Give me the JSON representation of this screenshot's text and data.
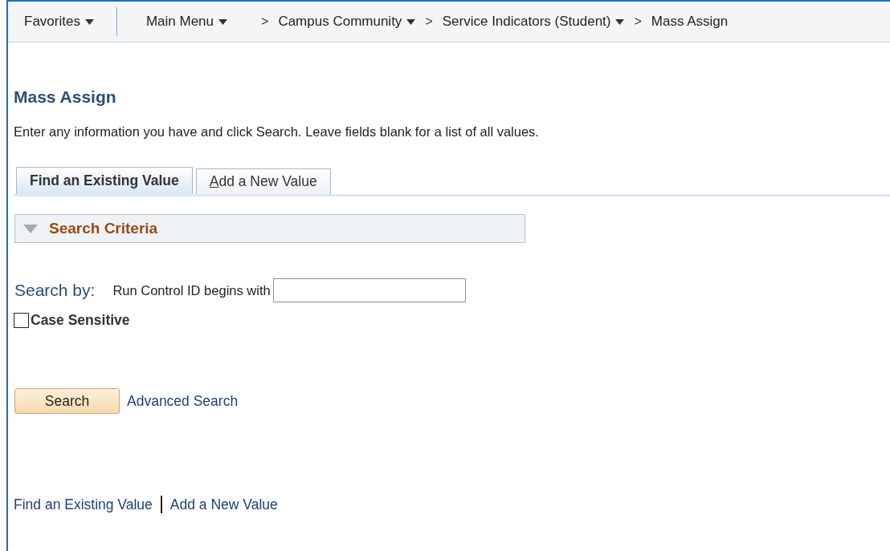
{
  "breadcrumb": {
    "favorites": {
      "label": "Favorites",
      "dropdown": true
    },
    "items": [
      {
        "label": "Main Menu",
        "dropdown": true
      },
      {
        "prefix": ">",
        "label": "Campus Community",
        "dropdown": true
      },
      {
        "prefix": ">",
        "label": "Service Indicators (Student)",
        "dropdown": true
      },
      {
        "prefix": ">",
        "label": "Mass Assign",
        "dropdown": false
      }
    ]
  },
  "page": {
    "title": "Mass Assign",
    "instructions": "Enter any information you have and click Search. Leave fields blank for a list of all values."
  },
  "tabs": [
    {
      "label": "Find an Existing Value",
      "selected": true,
      "access_key_underlined": false
    },
    {
      "label": "Add a New Value",
      "selected": false,
      "access_key_underlined": true
    }
  ],
  "search_criteria": {
    "title": "Search Criteria",
    "expanded": true,
    "search_by_label": "Search by:",
    "field_label": "Run Control ID begins with",
    "case_sensitive": {
      "label": "Case Sensitive",
      "checked": false
    }
  },
  "buttons": {
    "search": "Search",
    "advanced": "Advanced Search"
  },
  "footer_links": [
    "Find an Existing Value",
    "Add a New Value"
  ]
}
